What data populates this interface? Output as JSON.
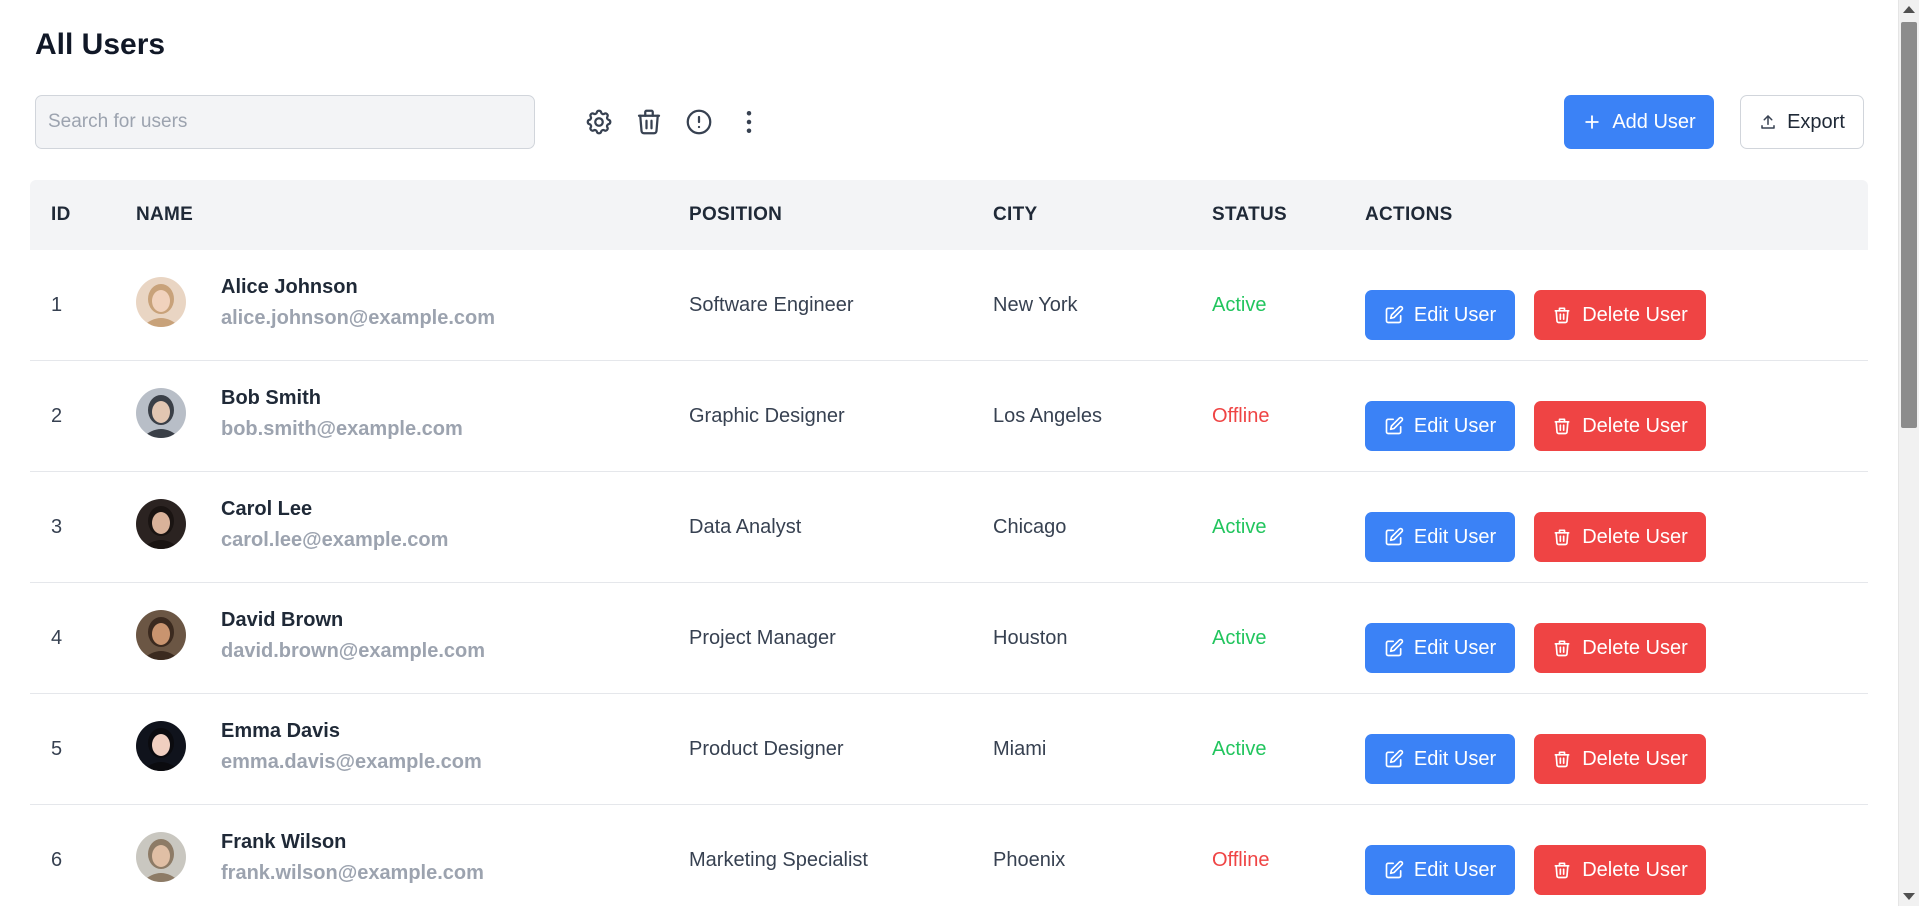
{
  "page": {
    "title": "All Users"
  },
  "search": {
    "placeholder": "Search for users",
    "value": ""
  },
  "toolbar": {
    "icons": [
      "gear-icon",
      "trash-icon",
      "alert-circle-icon",
      "more-vertical-icon"
    ],
    "add_label": "Add User",
    "export_label": "Export"
  },
  "table": {
    "headers": {
      "id": "ID",
      "name": "NAME",
      "position": "POSITION",
      "city": "CITY",
      "status": "STATUS",
      "actions": "ACTIONS"
    },
    "rows": [
      {
        "id": "1",
        "name": "Alice Johnson",
        "email": "alice.johnson@example.com",
        "position": "Software Engineer",
        "city": "New York",
        "status": "Active"
      },
      {
        "id": "2",
        "name": "Bob Smith",
        "email": "bob.smith@example.com",
        "position": "Graphic Designer",
        "city": "Los Angeles",
        "status": "Offline"
      },
      {
        "id": "3",
        "name": "Carol Lee",
        "email": "carol.lee@example.com",
        "position": "Data Analyst",
        "city": "Chicago",
        "status": "Active"
      },
      {
        "id": "4",
        "name": "David Brown",
        "email": "david.brown@example.com",
        "position": "Project Manager",
        "city": "Houston",
        "status": "Active"
      },
      {
        "id": "5",
        "name": "Emma Davis",
        "email": "emma.davis@example.com",
        "position": "Product Designer",
        "city": "Miami",
        "status": "Active"
      },
      {
        "id": "6",
        "name": "Frank Wilson",
        "email": "frank.wilson@example.com",
        "position": "Marketing Specialist",
        "city": "Phoenix",
        "status": "Offline"
      }
    ],
    "edit_label": "Edit User",
    "delete_label": "Delete User"
  },
  "colors": {
    "primary": "#3b82f6",
    "danger": "#ef4444",
    "active": "#22c55e",
    "offline": "#ef4444",
    "header_bg": "#f3f4f6"
  }
}
